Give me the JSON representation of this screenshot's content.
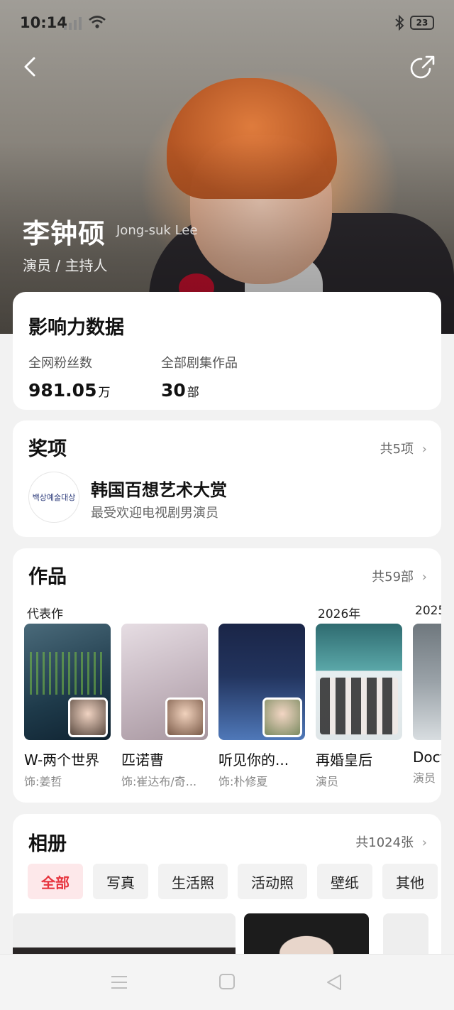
{
  "status": {
    "time": "10:14",
    "battery": "23"
  },
  "profile": {
    "name": "李钟硕",
    "english_name": "Jong-suk Lee",
    "roles": "演员 / 主持人"
  },
  "influence": {
    "title": "影响力数据",
    "stats": [
      {
        "label": "全网粉丝数",
        "value": "981.05",
        "unit": "万"
      },
      {
        "label": "全部剧集作品",
        "value": "30",
        "unit": "部"
      }
    ]
  },
  "awards": {
    "title": "奖项",
    "more": "共5项",
    "item": {
      "logo_text": "백상예술대상",
      "name": "韩国百想艺术大赏",
      "desc": "最受欢迎电视剧男演员"
    }
  },
  "works": {
    "title": "作品",
    "more": "共59部",
    "groups": [
      "代表作",
      "2026年",
      "2025"
    ],
    "items": [
      {
        "title": "W-两个世界",
        "role": "饰:姜哲",
        "poster_color": "#1e3a4a",
        "accent": "#7ac143"
      },
      {
        "title": "匹诺曹",
        "role": "饰:崔达布/奇...",
        "poster_color": "#c7b9c2",
        "accent": "#f1e6ea"
      },
      {
        "title": "听见你的...",
        "role": "饰:朴修夏",
        "poster_color": "#22345e",
        "accent": "#4f78b8"
      },
      {
        "title": "再婚皇后",
        "role": "演员",
        "poster_color": "#5aa7a8",
        "accent": "#e6eef0"
      },
      {
        "title": "Doct",
        "role": "演员",
        "poster_color": "#9aa2a8",
        "accent": "#d8dde0"
      }
    ]
  },
  "album": {
    "title": "相册",
    "more": "共1024张",
    "filters": [
      "全部",
      "写真",
      "生活照",
      "活动照",
      "壁纸",
      "其他"
    ],
    "active_filter": "全部"
  },
  "icons": [
    "back-icon",
    "share-icon",
    "chevron-right-icon",
    "menu-icon",
    "home-icon",
    "nav-back-icon"
  ],
  "colors": {
    "accent": "#e7353f",
    "chip_active_bg": "#fde8ea"
  }
}
